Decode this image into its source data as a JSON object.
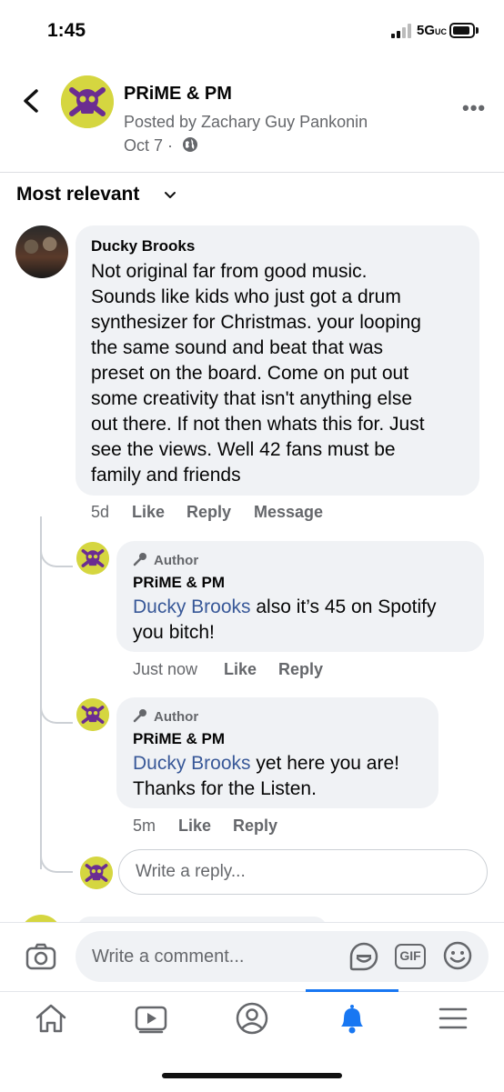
{
  "status_bar": {
    "time": "1:45",
    "network": "5G",
    "network_suffix": "UC"
  },
  "header": {
    "page_name": "PRiME & PM",
    "posted_by": "Posted by Zachary Guy Pankonin",
    "date": "Oct 7 ·",
    "more_label": "•••"
  },
  "sort": {
    "label": "Most relevant"
  },
  "comment": {
    "author": "Ducky Brooks",
    "text_lines": [
      "Not original far from good music.",
      "Sounds like kids who just got a drum",
      "synthesizer for Christmas. your looping",
      "the same sound and beat that was",
      "preset on the board. Come on put out",
      "some creativity that isn't anything else",
      "out there. If not then whats this for. Just",
      "see the views. Well 42 fans must be",
      "family and friends"
    ],
    "time": "5d",
    "like": "Like",
    "reply": "Reply",
    "message": "Message"
  },
  "replies": [
    {
      "badge": "Author",
      "author": "PRiME & PM",
      "mention": "Ducky Brooks",
      "line1_rest": " also it’s 45 on Spotify",
      "line2": "you bitch!",
      "time": "Just now",
      "like": "Like",
      "reply": "Reply"
    },
    {
      "badge": "Author",
      "author": "PRiME & PM",
      "mention": "Ducky Brooks",
      "line1_rest": " yet here you are!",
      "line2": "Thanks for the Listen.",
      "time": "5m",
      "like": "Like",
      "reply": "Reply"
    }
  ],
  "reply_input": {
    "placeholder": "Write a reply..."
  },
  "composer": {
    "placeholder": "Write a comment...",
    "gif_label": "GIF"
  },
  "tabs": [
    "home",
    "watch",
    "profile",
    "notifications",
    "menu"
  ],
  "colors": {
    "accent": "#1877f2",
    "link": "#385898",
    "brand_yellow": "#d5d640",
    "brand_purple": "#6b2d91"
  }
}
